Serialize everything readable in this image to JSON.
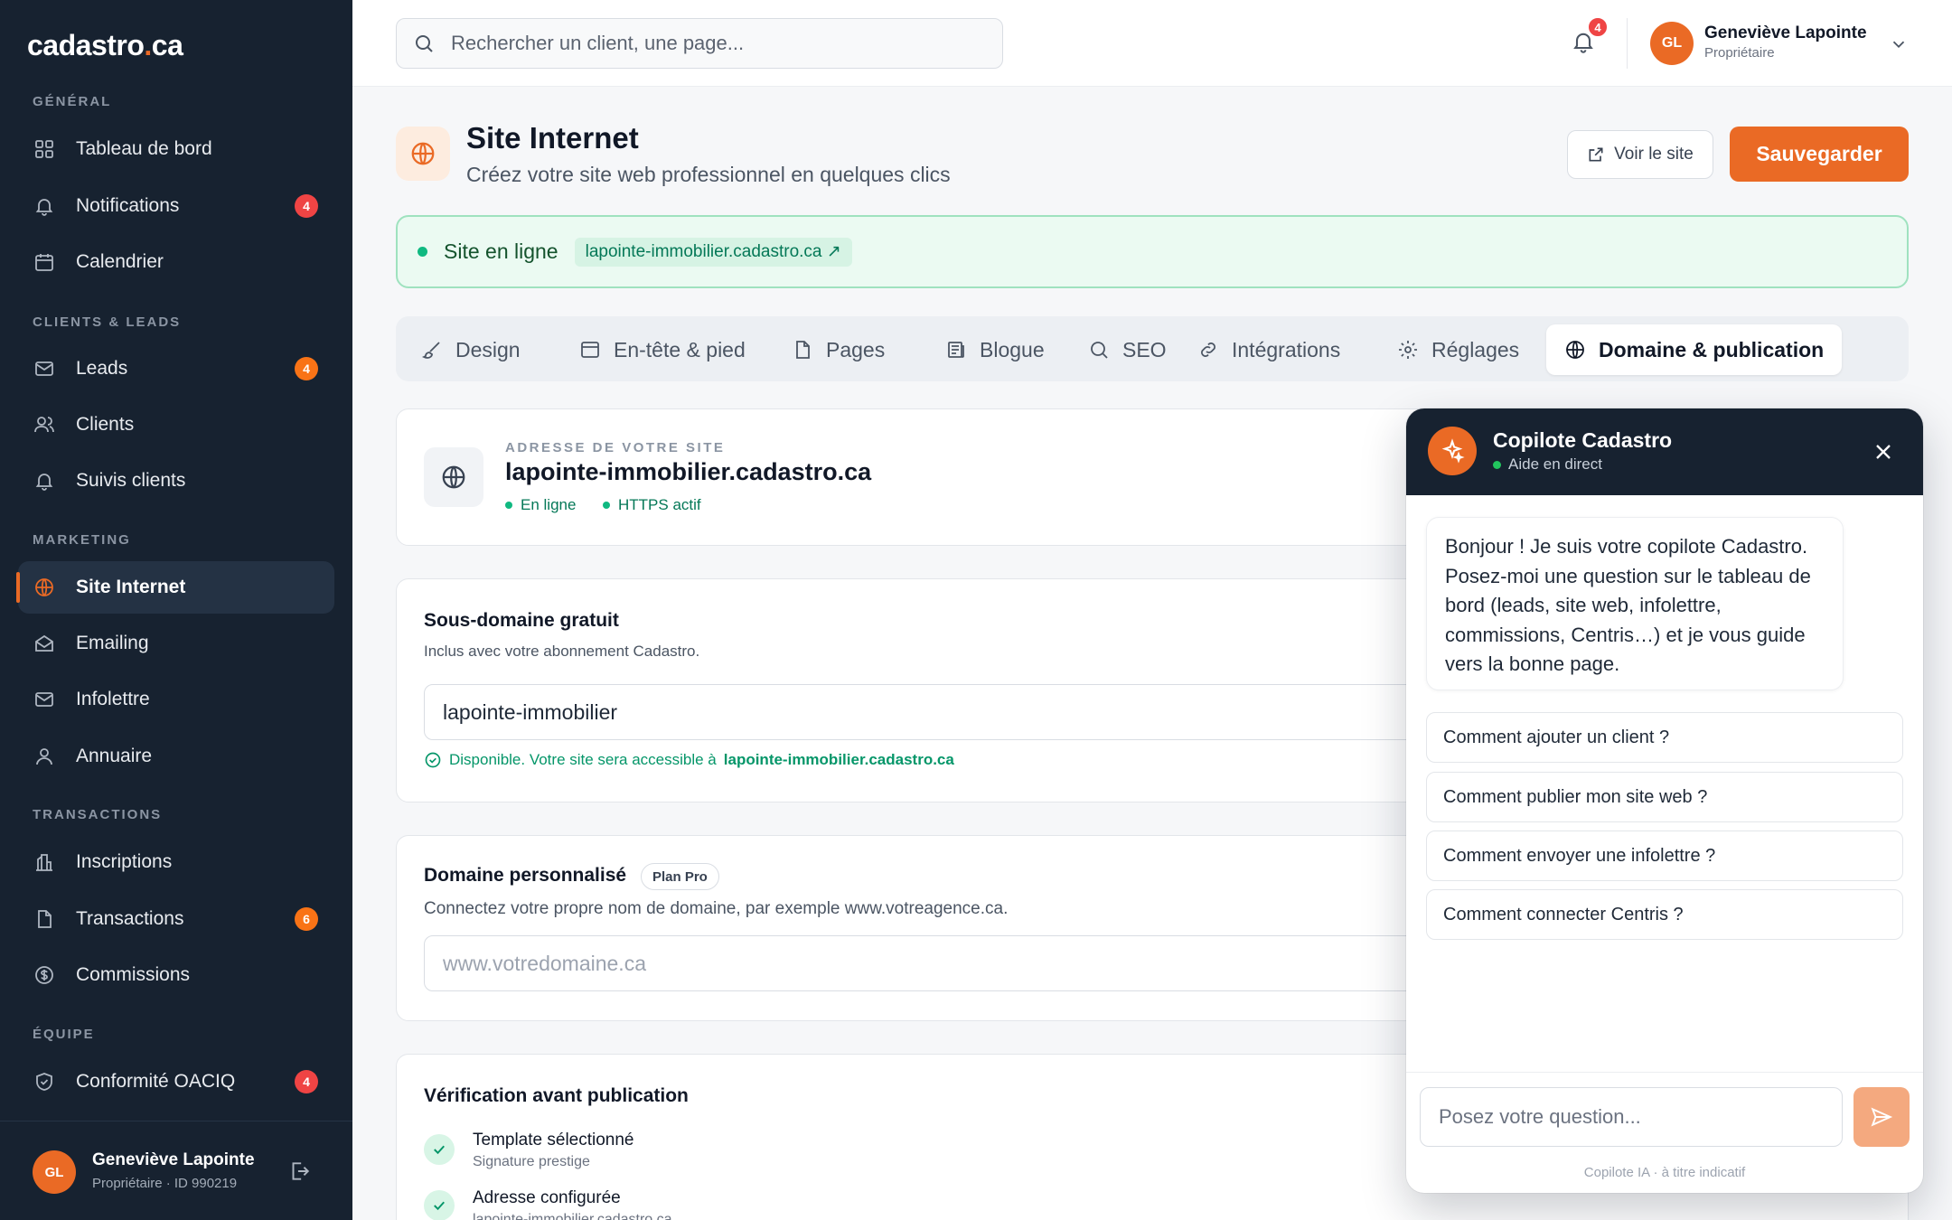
{
  "brand": {
    "name": "cadastro",
    "dot": ".",
    "tld": "ca",
    "accent": "#ea6a25"
  },
  "sidebar": {
    "sections": [
      "GÉNÉRAL",
      "CLIENTS & LEADS",
      "MARKETING",
      "TRANSACTIONS",
      "ÉQUIPE"
    ],
    "items": [
      {
        "label": "Tableau de bord",
        "icon": "dashboard-icon"
      },
      {
        "label": "Notifications",
        "icon": "bell-icon",
        "badge": "4"
      },
      {
        "label": "Calendrier",
        "icon": "calendar-icon"
      },
      {
        "label": "Leads",
        "icon": "mail-icon",
        "badge": "4"
      },
      {
        "label": "Clients",
        "icon": "users-icon"
      },
      {
        "label": "Suivis clients",
        "icon": "bell-icon"
      },
      {
        "label": "Site Internet",
        "icon": "globe-icon",
        "active": true
      },
      {
        "label": "Emailing",
        "icon": "mail-open-icon"
      },
      {
        "label": "Infolettre",
        "icon": "mail-icon"
      },
      {
        "label": "Annuaire",
        "icon": "user-icon"
      },
      {
        "label": "Inscriptions",
        "icon": "building-chart-icon"
      },
      {
        "label": "Transactions",
        "icon": "file-icon",
        "badge": "6"
      },
      {
        "label": "Commissions",
        "icon": "dollar-icon"
      },
      {
        "label": "Conformité OACIQ",
        "icon": "shield-icon",
        "badge": "4"
      }
    ],
    "user": {
      "initials": "GL",
      "name": "Geneviève Lapointe",
      "role": "Propriétaire · ID 990219"
    }
  },
  "topbar": {
    "search_placeholder": "Rechercher un client, une page...",
    "notif_count": "4",
    "user": {
      "initials": "GL",
      "name": "Geneviève Lapointe",
      "role": "Propriétaire"
    }
  },
  "header": {
    "title": "Site Internet",
    "subtitle": "Créez votre site web professionnel en quelques clics",
    "view_label": "Voir le site",
    "save_label": "Sauvegarder"
  },
  "status_bar": {
    "label": "Site en ligne",
    "url": "lapointe-immobilier.cadastro.ca ↗"
  },
  "tabs": [
    {
      "label": "Design",
      "icon": "brush-icon"
    },
    {
      "label": "En-tête & pied",
      "icon": "layout-icon"
    },
    {
      "label": "Pages",
      "icon": "file-icon"
    },
    {
      "label": "Blogue",
      "icon": "newspaper-icon"
    },
    {
      "label": "SEO",
      "icon": "search-icon"
    },
    {
      "label": "Intégrations",
      "icon": "link-icon"
    },
    {
      "label": "Réglages",
      "icon": "gear-icon"
    },
    {
      "label": "Domaine & publication",
      "icon": "globe-icon",
      "active": true
    }
  ],
  "site_card": {
    "eyebrow": "ADRESSE DE VOTRE SITE",
    "domain": "lapointe-immobilier.cadastro.ca",
    "status_online": "En ligne",
    "status_https": "HTTPS actif"
  },
  "subdomain": {
    "title": "Sous-domaine gratuit",
    "subtitle": "Inclus avec votre abonnement Cadastro.",
    "value": "lapointe-immobilier",
    "available_text": "Disponible. Votre site sera accessible à",
    "available_domain": "lapointe-immobilier.cadastro.ca"
  },
  "custom_domain": {
    "title": "Domaine personnalisé",
    "plan": "Plan Pro",
    "subtitle": "Connectez votre propre nom de domaine, par exemple www.votreagence.ca.",
    "placeholder": "www.votredomaine.ca"
  },
  "verification": {
    "title": "Vérification avant publication",
    "items": [
      {
        "title": "Template sélectionné",
        "sub": "Signature prestige"
      },
      {
        "title": "Adresse configurée",
        "sub": "lapointe-immobilier.cadastro.ca"
      }
    ]
  },
  "copilot": {
    "title": "Copilote Cadastro",
    "status": "Aide en direct",
    "message": "Bonjour ! Je suis votre copilote Cadastro. Posez-moi une question sur le tableau de bord (leads, site web, infolettre, commissions, Centris…) et je vous guide vers la bonne page.",
    "suggestions": [
      "Comment ajouter un client ?",
      "Comment publier mon site web ?",
      "Comment envoyer une infolettre ?",
      "Comment connecter Centris ?"
    ],
    "input_placeholder": "Posez votre question...",
    "disclaimer": "Copilote IA · à titre indicatif"
  }
}
